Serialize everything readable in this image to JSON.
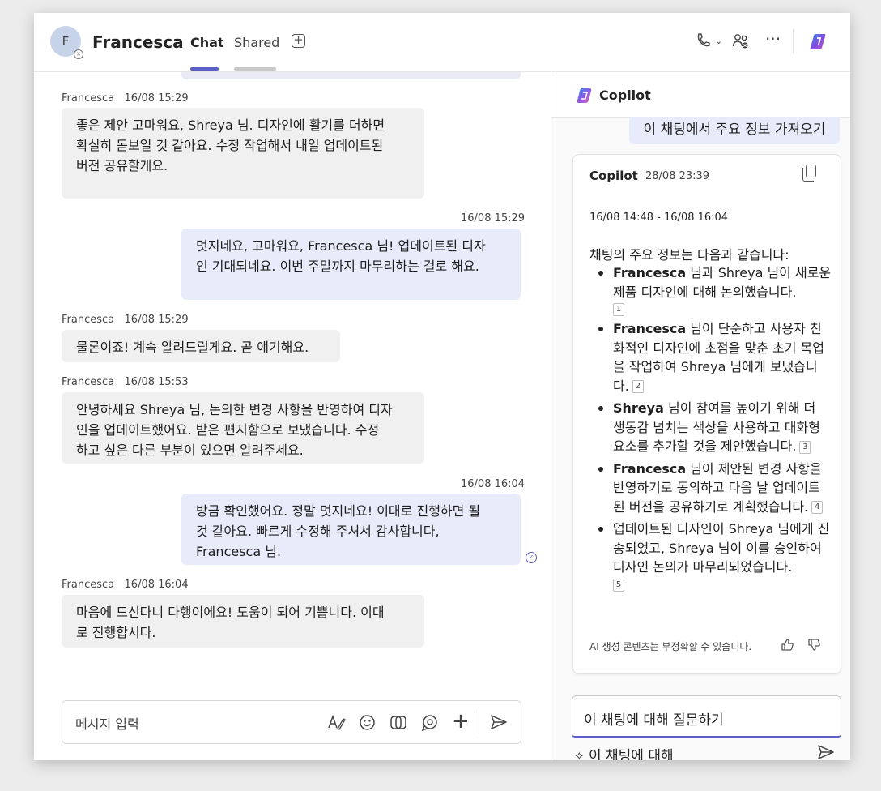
{
  "header": {
    "avatar_initial": "F",
    "contact_name": "Francesca",
    "tabs": [
      {
        "label": "Chat",
        "active": true
      },
      {
        "label": "Shared",
        "active": false
      }
    ],
    "accent_color": "#5b5fc7"
  },
  "chat": {
    "messages": [
      {
        "sender": "Francesca",
        "time": "16/08 15:29",
        "direction": "in",
        "text": "좋은 제안 고마워요, Shreya 님. 디자인에 활기를 더하면\n확실히 돋보일 것 같아요. 수정 작업해서 내일 업데이트된\n버전 공유할게요."
      },
      {
        "sender": "",
        "time": "16/08 15:29",
        "direction": "out",
        "text": "멋지네요, 고마워요, Francesca 님! 업데이트된 디자\n인 기대되네요. 이번 주말까지 마무리하는 걸로 해요."
      },
      {
        "sender": "Francesca",
        "time": "16/08 15:29",
        "direction": "in",
        "text": "물론이죠! 계속 알려드릴게요. 곧 얘기해요."
      },
      {
        "sender": "Francesca",
        "time": "16/08 15:53",
        "direction": "in",
        "text": "안녕하세요 Shreya 님, 논의한 변경 사항을 반영하여 디자\n인을 업데이트했어요. 받은 편지함으로 보냈습니다. 수정\n하고 싶은 다른 부분이 있으면 알려주세요."
      },
      {
        "sender": "",
        "time": "16/08 16:04",
        "direction": "out",
        "text": "방금 확인했어요. 정말 멋지네요! 이대로 진행하면 될\n것 같아요. 빠르게 수정해 주셔서 감사합니다,\nFrancesca 님."
      },
      {
        "sender": "Francesca",
        "time": "16/08 16:04",
        "direction": "in",
        "text": "마음에 드신다니 다행이에요! 도움이 되어 기쁩니다. 이대\n로 진행합시다."
      }
    ],
    "composer_placeholder": "메시지 입력"
  },
  "copilot": {
    "title": "Copilot",
    "user_query": "이 채팅에서 주요 정보 가져오기",
    "response": {
      "author": "Copilot",
      "timestamp": "28/08 23:39",
      "range": "16/08 14:48 - 16/08 16:04",
      "intro": "채팅의 주요 정보는 다음과 같습니다:",
      "points": [
        {
          "bold": "Francesca",
          "text": " 님과 Shreya 님이 새로운 제품 디자인에 대해 논의했습니다.",
          "cite": "1"
        },
        {
          "bold": "Francesca",
          "text": " 님이 단순하고 사용자 친화적인 디자인에 초점을 맞춘 초기 목업을 작업하여 Shreya 님에게 보냈습니다.",
          "cite": "2"
        },
        {
          "bold": "Shreya",
          "text": " 님이 참여를 높이기 위해 더 생동감 넘치는 색상을 사용하고 대화형 요소를 추가할 것을 제안했습니다.",
          "cite": "3"
        },
        {
          "bold": "Francesca",
          "text": " 님이 제안된 변경 사항을 반영하기로 동의하고 다음 날 업데이트된 버전을 공유하기로 계획했습니다.",
          "cite": "4"
        },
        {
          "bold": "",
          "text": "업데이트된 디자인이 Shreya 님에게 진송되었고, Shreya 님이 이를 승인하여 디자인 논의가 마무리되었습니다.",
          "cite": "5"
        }
      ],
      "disclaimer": "AI 생성 콘텐츠는 부정확할 수 있습니다."
    },
    "ask_input": "이 채팅에 대해 질문하기",
    "prompt_suggestion": "이 채팅에 대해"
  }
}
